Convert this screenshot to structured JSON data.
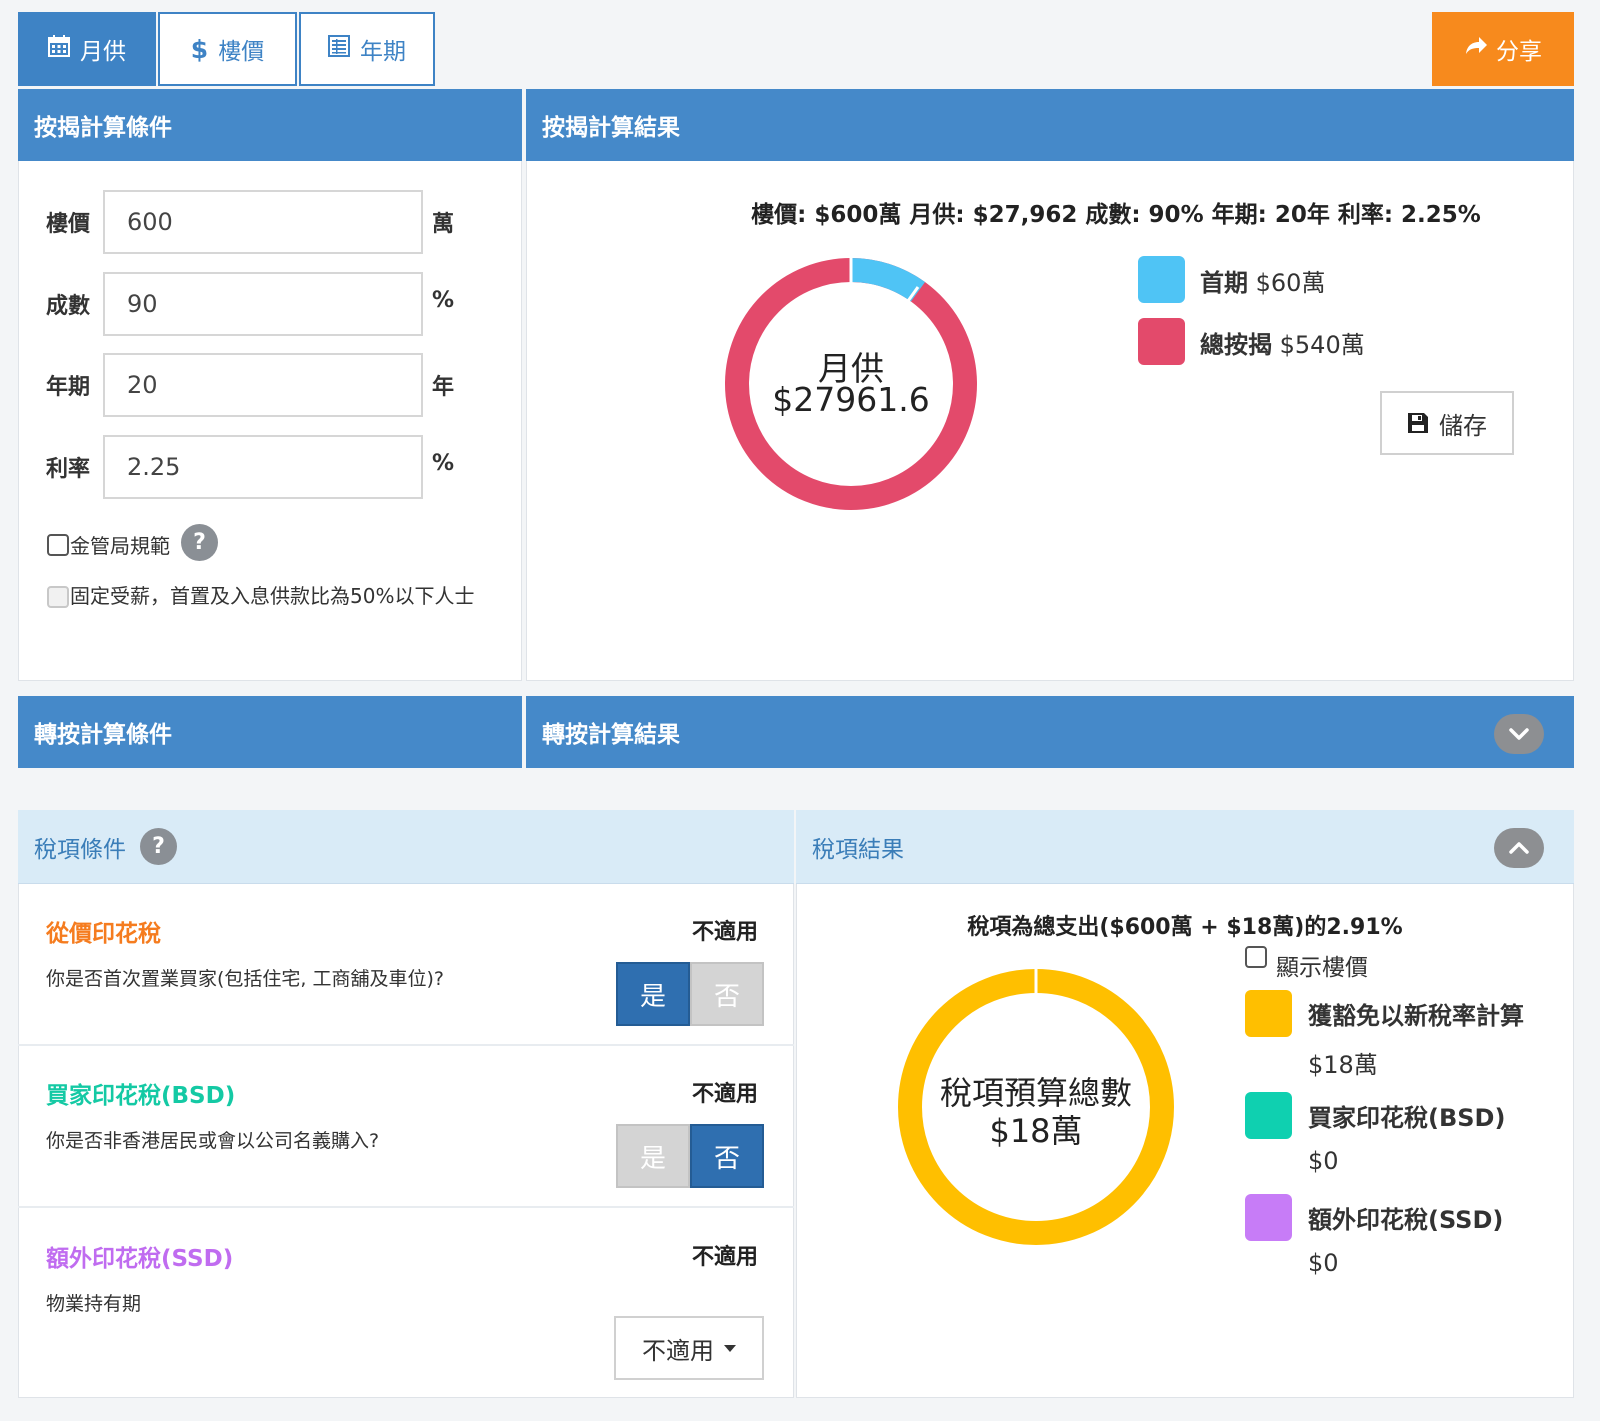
{
  "tabs": [
    {
      "icon": "calendar-icon",
      "label": "月供"
    },
    {
      "icon": "dollar-icon",
      "label": "樓價"
    },
    {
      "icon": "table-icon",
      "label": "年期"
    }
  ],
  "share_label": "分享",
  "calc": {
    "header": "按揭計算條件",
    "fields": [
      {
        "label": "樓價",
        "value": "600",
        "unit": "萬"
      },
      {
        "label": "成數",
        "value": "90",
        "unit": "%"
      },
      {
        "label": "年期",
        "value": "20",
        "unit": "年"
      },
      {
        "label": "利率",
        "value": "2.25",
        "unit": "%"
      }
    ],
    "hkma_label": "金管局規範",
    "fixed_income_label": "固定受薪，首置及入息供款比為50%以下人士"
  },
  "result": {
    "header": "按揭計算結果",
    "summary": "樓價: $600萬 月供: $27,962 成數: 90% 年期: 20年 利率: 2.25%",
    "donut_label": "月供",
    "donut_value": "$27961.6",
    "legend": [
      {
        "name": "首期",
        "value": "$60萬",
        "color": "#4fc4f5"
      },
      {
        "name": "總按揭",
        "value": "$540萬",
        "color": "#e34a6b"
      }
    ],
    "save_label": "儲存"
  },
  "refinance": {
    "cond_header": "轉按計算條件",
    "result_header": "轉按計算結果"
  },
  "tax": {
    "cond_header": "稅項條件",
    "result_header": "稅項結果",
    "items": [
      {
        "title": "從價印花稅",
        "color": "#f57c1f",
        "question": "你是否首次置業買家(包括住宅, 工商舖及車位)?",
        "status": "不適用",
        "yes": "是",
        "no": "否",
        "selected": "yes"
      },
      {
        "title": "買家印花稅(BSD)",
        "color": "#14c9a4",
        "question": "你是否非香港居民或會以公司名義購入?",
        "status": "不適用",
        "yes": "是",
        "no": "否",
        "selected": "no"
      },
      {
        "title": "額外印花稅(SSD)",
        "color": "#c06cf0",
        "question": "物業持有期",
        "status": "不適用",
        "dropdown": "不適用"
      }
    ],
    "summary": "稅項為總支出($600萬 + $18萬)的2.91%",
    "show_price_label": "顯示樓價",
    "donut_label": "稅項預算總數",
    "donut_value": "$18萬",
    "legend": [
      {
        "name": "獲豁免以新稅率計算",
        "value": "$18萬",
        "color": "#ffbf00"
      },
      {
        "name": "買家印花稅(BSD)",
        "value": "$0",
        "color": "#0fd0b0"
      },
      {
        "name": "額外印花稅(SSD)",
        "value": "$0",
        "color": "#c77cf7"
      }
    ]
  }
}
